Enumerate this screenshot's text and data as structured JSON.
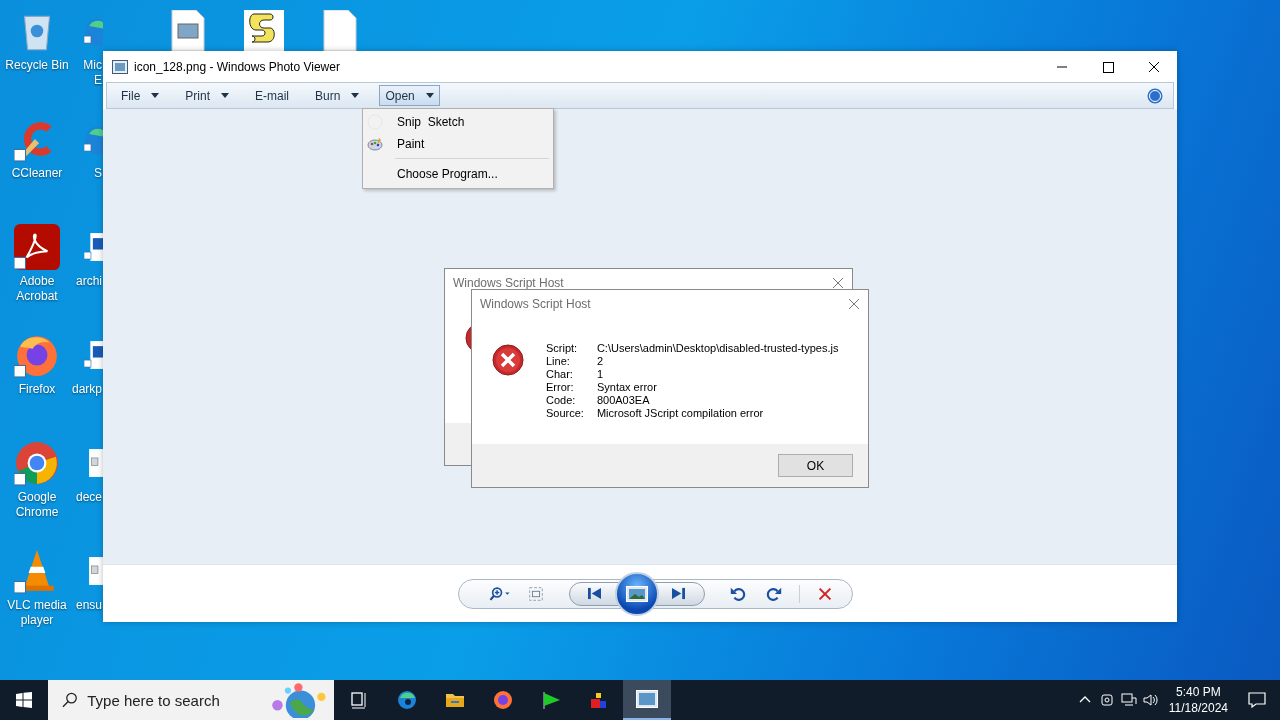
{
  "desktop_icons": [
    {
      "kind": "recycle",
      "lines": [
        "Recycle Bin"
      ]
    },
    {
      "kind": "ccleaner",
      "lines": [
        "CCleaner"
      ]
    },
    {
      "kind": "acrobat",
      "lines": [
        "Adobe",
        "Acrobat"
      ]
    },
    {
      "kind": "firefox",
      "lines": [
        "Firefox"
      ]
    },
    {
      "kind": "chrome",
      "lines": [
        "Google",
        "Chrome"
      ]
    },
    {
      "kind": "vlc",
      "lines": [
        "VLC media",
        "player"
      ]
    }
  ],
  "desktop_icons_col2": [
    {
      "kind": "edge",
      "lines": [
        "Mic",
        "E"
      ]
    },
    {
      "kind": "edge",
      "lines": [
        "S"
      ]
    },
    {
      "kind": "word",
      "lines": [
        "archi"
      ]
    },
    {
      "kind": "word",
      "lines": [
        "darkp"
      ]
    },
    {
      "kind": "imagefile",
      "lines": [
        "dece"
      ]
    },
    {
      "kind": "imagefile",
      "lines": [
        "ensu"
      ]
    }
  ],
  "desktop_icons_top": [
    {
      "kind": "imagefile"
    },
    {
      "kind": "script"
    },
    {
      "kind": "blank"
    }
  ],
  "window": {
    "title": "icon_128.png - Windows Photo Viewer",
    "menu": [
      {
        "label": "File",
        "dropdown": true,
        "expanded": false
      },
      {
        "label": "Print",
        "dropdown": true,
        "expanded": false
      },
      {
        "label": "E-mail",
        "dropdown": false,
        "expanded": false
      },
      {
        "label": "Burn",
        "dropdown": true,
        "expanded": false
      },
      {
        "label": "Open",
        "dropdown": true,
        "expanded": true
      }
    ],
    "open_menu": [
      {
        "kind": "snip",
        "label": "Snip  Sketch"
      },
      {
        "kind": "paint",
        "label": "Paint"
      },
      {
        "kind": "separator"
      },
      {
        "kind": "plain",
        "label": "Choose Program..."
      }
    ]
  },
  "back_dialog": {
    "title": "Windows Script Host"
  },
  "dialog": {
    "title": "Windows Script Host",
    "fields": [
      {
        "label": "Script:",
        "value": "C:\\Users\\admin\\Desktop\\disabled-trusted-types.js"
      },
      {
        "label": "Line:",
        "value": "2"
      },
      {
        "label": "Char:",
        "value": "1"
      },
      {
        "label": "Error:",
        "value": "Syntax error"
      },
      {
        "label": "Code:",
        "value": "800A03EA"
      },
      {
        "label": "Source:",
        "value": "Microsoft JScript compilation error"
      }
    ],
    "button": "OK"
  },
  "taskbar": {
    "search_placeholder": "Type here to search",
    "apps": [
      {
        "kind": "taskview",
        "active": false
      },
      {
        "kind": "edge",
        "active": false
      },
      {
        "kind": "folder",
        "active": false
      },
      {
        "kind": "firefox",
        "active": false
      },
      {
        "kind": "flag",
        "active": false
      },
      {
        "kind": "blocks",
        "active": false
      },
      {
        "kind": "photo",
        "active": true
      }
    ],
    "time": "5:40 PM",
    "date": "11/18/2024"
  }
}
